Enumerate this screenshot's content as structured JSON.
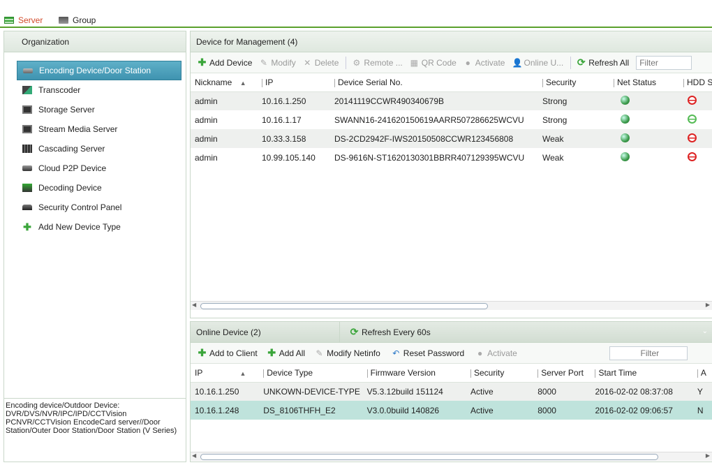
{
  "tabs": [
    {
      "label": "Server",
      "icon": "server-icon",
      "active": true
    },
    {
      "label": "Group",
      "icon": "group-icon",
      "active": false
    }
  ],
  "organization": {
    "title": "Organization",
    "items": [
      {
        "label": "Encoding Device/Door Station",
        "icon": "encoding-device-icon",
        "selected": true
      },
      {
        "label": "Transcoder",
        "icon": "transcoder-icon"
      },
      {
        "label": "Storage Server",
        "icon": "storage-server-icon"
      },
      {
        "label": "Stream Media Server",
        "icon": "stream-media-server-icon"
      },
      {
        "label": "Cascading Server",
        "icon": "cascading-server-icon"
      },
      {
        "label": "Cloud P2P Device",
        "icon": "cloud-p2p-icon"
      },
      {
        "label": "Decoding Device",
        "icon": "decoding-device-icon"
      },
      {
        "label": "Security Control Panel",
        "icon": "security-panel-icon"
      },
      {
        "label": "Add New Device Type",
        "icon": "plus-icon"
      }
    ],
    "description": "Encoding device/Outdoor Device: DVR/DVS/NVR/IPC/IPD/CCTVision PCNVR/CCTVision EncodeCard server//Door Station/Outer Door Station/Door Station (V Series)"
  },
  "management": {
    "title": "Device for Management (4)",
    "toolbar": {
      "add_device": "Add Device",
      "modify": "Modify",
      "delete": "Delete",
      "remote": "Remote ...",
      "qr_code": "QR Code",
      "activate": "Activate",
      "online_user": "Online U...",
      "refresh_all": "Refresh All",
      "filter_placeholder": "Filter"
    },
    "columns": [
      "Nickname",
      "IP",
      "Device Serial No.",
      "Security",
      "Net Status",
      "HDD S"
    ],
    "rows": [
      {
        "nickname": "admin",
        "ip": "10.16.1.250",
        "serial": "20141119CCWR490340679B",
        "security": "Strong",
        "net": "online",
        "hdd": "abnormal"
      },
      {
        "nickname": "admin",
        "ip": "10.16.1.17",
        "serial": "SWANN16-241620150619AARR507286625WCVU",
        "security": "Strong",
        "net": "online",
        "hdd": "normal"
      },
      {
        "nickname": "admin",
        "ip": "10.33.3.158",
        "serial": "DS-2CD2942F-IWS20150508CCWR123456808",
        "security": "Weak",
        "net": "online",
        "hdd": "abnormal"
      },
      {
        "nickname": "admin",
        "ip": "10.99.105.140",
        "serial": "DS-9616N-ST1620130301BBRR407129395WCVU",
        "security": "Weak",
        "net": "online",
        "hdd": "abnormal"
      }
    ]
  },
  "online": {
    "title": "Online Device (2)",
    "refresh": "Refresh Every 60s",
    "toolbar": {
      "add_to_client": "Add to Client",
      "add_all": "Add All",
      "modify_netinfo": "Modify Netinfo",
      "reset_password": "Reset Password",
      "activate": "Activate",
      "filter_placeholder": "Filter"
    },
    "columns": [
      "IP",
      "Device Type",
      "Firmware Version",
      "Security",
      "Server Port",
      "Start Time",
      "A"
    ],
    "rows": [
      {
        "ip": "10.16.1.250",
        "type": "UNKOWN-DEVICE-TYPE",
        "firmware": "V5.3.12build 151124",
        "security": "Active",
        "port": "8000",
        "start": "2016-02-02 08:37:08",
        "extra": "Y"
      },
      {
        "ip": "10.16.1.248",
        "type": "DS_8106THFH_E2",
        "firmware": "V3.0.0build 140826",
        "security": "Active",
        "port": "8000",
        "start": "2016-02-02 09:06:57",
        "extra": "N"
      }
    ]
  }
}
